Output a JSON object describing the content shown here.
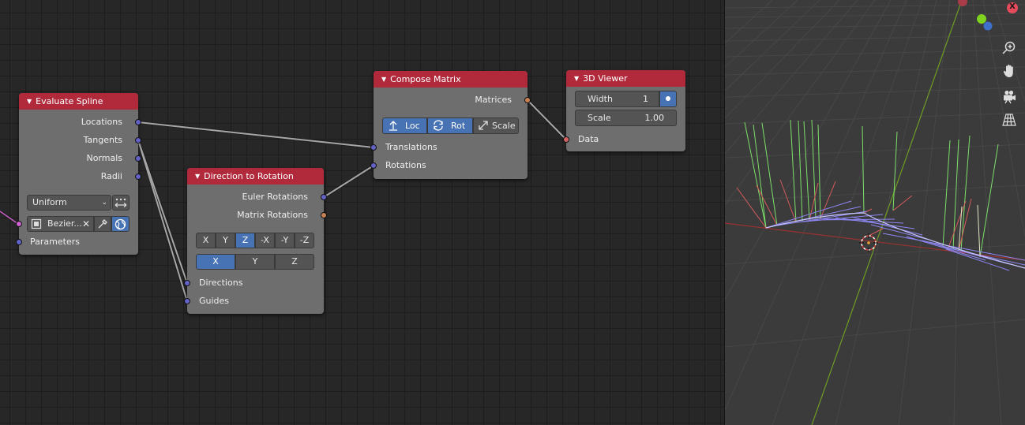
{
  "nodes": {
    "evaluate_spline": {
      "title": "Evaluate Spline",
      "outputs": [
        "Locations",
        "Tangents",
        "Normals",
        "Radii"
      ],
      "mode": "Uniform",
      "object": "Bezier...",
      "input": "Parameters"
    },
    "direction_to_rotation": {
      "title": "Direction to Rotation",
      "outputs": [
        "Euler Rotations",
        "Matrix Rotations"
      ],
      "primary_axes": [
        "X",
        "Y",
        "Z",
        "-X",
        "-Y",
        "-Z"
      ],
      "primary_selected": "Z",
      "secondary_axes": [
        "X",
        "Y",
        "Z"
      ],
      "secondary_selected": "X",
      "inputs": [
        "Directions",
        "Guides"
      ]
    },
    "compose_matrix": {
      "title": "Compose Matrix",
      "output": "Matrices",
      "toggles": [
        "Loc",
        "Rot",
        "Scale"
      ],
      "toggles_active": [
        "Loc",
        "Rot"
      ],
      "inputs": [
        "Translations",
        "Rotations"
      ]
    },
    "viewer_3d": {
      "title": "3D Viewer",
      "width_label": "Width",
      "width_value": "1",
      "scale_label": "Scale",
      "scale_value": "1.00",
      "input": "Data"
    }
  },
  "viewport": {
    "gizmo_axis_label": "X",
    "tools": [
      "zoom-icon",
      "hand-pan-icon",
      "camera-icon",
      "grid-ortho-icon"
    ]
  },
  "colors": {
    "node_header": "#b02a3c",
    "socket_vector": "#6363c7",
    "socket_matrix": "#c88253",
    "socket_generic": "#d56262",
    "active_button": "#4772b3"
  }
}
